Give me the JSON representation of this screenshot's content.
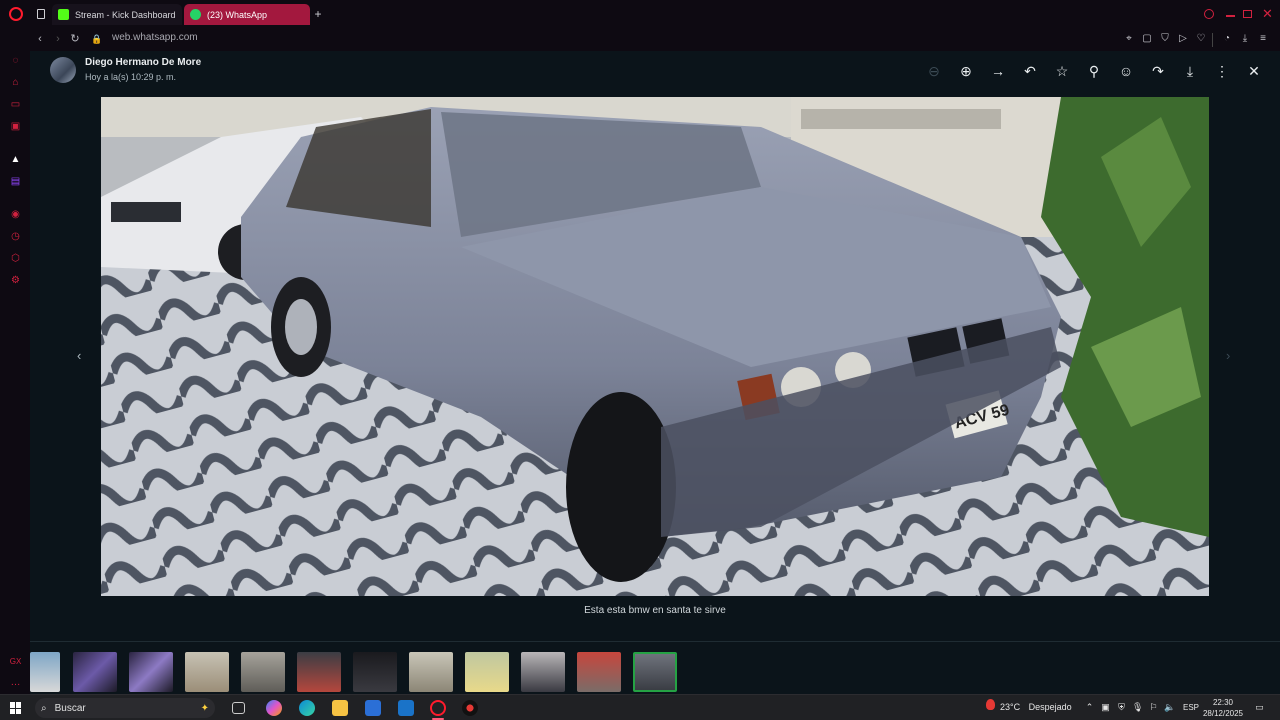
{
  "browser": {
    "tabs": [
      {
        "label": "Stream - Kick Dashboard"
      },
      {
        "label": "(23) WhatsApp"
      }
    ],
    "new_tab_label": "+",
    "url": "web.whatsapp.com"
  },
  "viewer": {
    "sender": "Diego Hermano De More",
    "timestamp": "Hoy a la(s) 10:29 p. m.",
    "caption": "Esta esta bmw en santa te sirve",
    "toolbar_icons": [
      "zoom-in-icon",
      "forward-icon",
      "reply-icon",
      "star-icon",
      "pin-icon",
      "emoji-icon",
      "share-icon",
      "download-icon",
      "more-icon",
      "close-icon"
    ],
    "thumbnails_count": 12,
    "photo_plate_text": "ACV 59"
  },
  "taskbar": {
    "search_placeholder": "Buscar",
    "weather_temp": "23°C",
    "weather_desc": "Despejado",
    "language": "ESP",
    "time": "22:30",
    "date": "28/12/2025"
  },
  "colors": {
    "accent_tab": "#a3183e",
    "opera_red": "#d2213f",
    "viewer_bg": "#0b141a",
    "selected_thumb_border": "#25a244"
  }
}
